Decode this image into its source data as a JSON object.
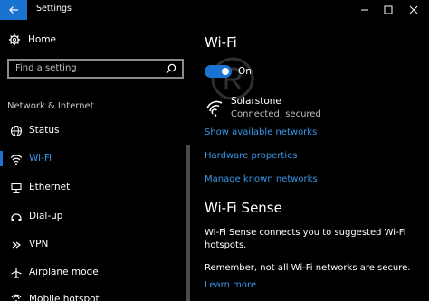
{
  "window": {
    "title": "Settings"
  },
  "sidebar": {
    "home_label": "Home",
    "search_placeholder": "Find a setting",
    "section_label": "Network & Internet",
    "items": [
      {
        "label": "Status",
        "icon": "globe-icon"
      },
      {
        "label": "Wi-Fi",
        "icon": "wifi-icon",
        "selected": true
      },
      {
        "label": "Ethernet",
        "icon": "ethernet-icon"
      },
      {
        "label": "Dial-up",
        "icon": "dial-up-icon"
      },
      {
        "label": "VPN",
        "icon": "vpn-icon"
      },
      {
        "label": "Airplane mode",
        "icon": "airplane-icon"
      },
      {
        "label": "Mobile hotspot",
        "icon": "hotspot-icon"
      }
    ]
  },
  "main": {
    "wifi_title": "Wi-Fi",
    "toggle_state": "On",
    "network": {
      "name": "Solarstone",
      "status": "Connected, secured"
    },
    "links": {
      "show_networks": "Show available networks",
      "hardware": "Hardware properties",
      "manage": "Manage known networks"
    },
    "sense": {
      "title": "Wi-Fi Sense",
      "description": "Wi-Fi Sense connects you to suggested Wi-Fi hotspots.",
      "note": "Remember, not all Wi-Fi networks are secure.",
      "learn_more": "Learn more"
    }
  },
  "colors": {
    "accent": "#1a73d0",
    "link": "#3a96e8",
    "background": "#000000"
  }
}
